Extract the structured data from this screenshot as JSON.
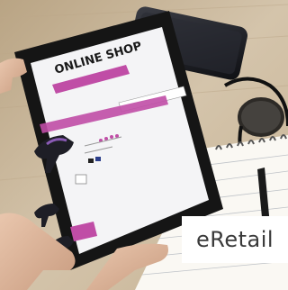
{
  "photo": {
    "subject_icons": [
      "tablet-icon",
      "smartphone-icon",
      "eyeglasses-icon",
      "notebook-icon",
      "pen-icon",
      "hands-icon",
      "shoe-icon"
    ],
    "colors": {
      "table_wood": "#c9b79e",
      "tablet_frame": "#151515",
      "screen_bg": "#f4f4f6",
      "accent_magenta": "#c04da6",
      "caption_text": "#3a3a3a"
    }
  },
  "screen": {
    "shop_title": "ONLINE SHOP"
  },
  "caption": {
    "text": "eRetail"
  }
}
